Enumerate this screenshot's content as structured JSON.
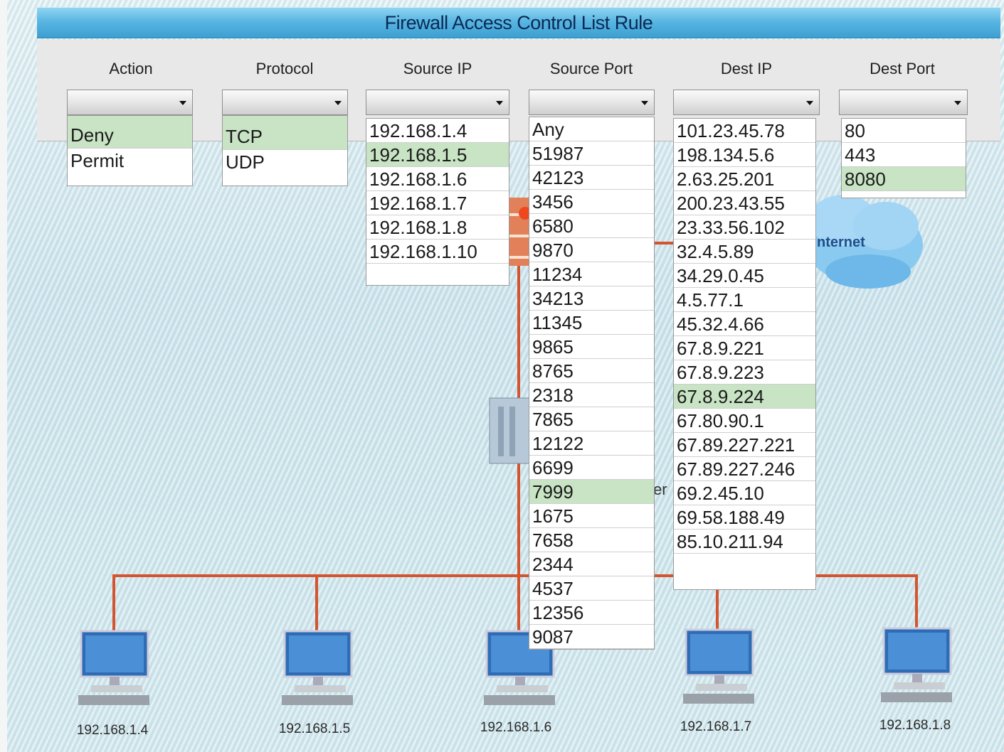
{
  "title": "Firewall Access Control List Rule",
  "columns": {
    "action": "Action",
    "protocol": "Protocol",
    "source_ip": "Source IP",
    "source_port": "Source Port",
    "dest_ip": "Dest IP",
    "dest_port": "Dest Port"
  },
  "action_options": [
    "Deny",
    "Permit"
  ],
  "action_selected": "Deny",
  "protocol_options": [
    "TCP",
    "UDP"
  ],
  "protocol_selected": "TCP",
  "source_ip_options": [
    "192.168.1.4",
    "192.168.1.5",
    "192.168.1.6",
    "192.168.1.7",
    "192.168.1.8",
    "192.168.1.10"
  ],
  "source_ip_selected": "192.168.1.5",
  "source_port_options": [
    "Any",
    "51987",
    "42123",
    "3456",
    "6580",
    "9870",
    "11234",
    "34213",
    "11345",
    "9865",
    "8765",
    "2318",
    "7865",
    "12122",
    "6699",
    "7999",
    "1675",
    "7658",
    "2344",
    "4537",
    "12356",
    "9087"
  ],
  "source_port_selected": "7999",
  "dest_ip_options": [
    "101.23.45.78",
    "198.134.5.6",
    "2.63.25.201",
    "200.23.43.55",
    "23.33.56.102",
    "32.4.5.89",
    "34.29.0.45",
    "4.5.77.1",
    "45.32.4.66",
    "67.8.9.221",
    "67.8.9.223",
    "67.8.9.224",
    "67.80.90.1",
    "67.89.227.221",
    "67.89.227.246",
    "69.2.45.10",
    "69.58.188.49",
    "85.10.211.94"
  ],
  "dest_ip_selected": "67.8.9.224",
  "dest_port_options": [
    "80",
    "443",
    "8080"
  ],
  "dest_port_selected": "8080",
  "network": {
    "cloud_label": "nternet",
    "server_label_fragment": "er",
    "hosts": [
      "192.168.1.4",
      "192.168.1.5",
      "192.168.1.6",
      "192.168.1.7",
      "192.168.1.8"
    ]
  },
  "colors": {
    "selected_row": "#c8e4c4",
    "title_bar": "#59b6e2",
    "wire": "#d4542f"
  }
}
